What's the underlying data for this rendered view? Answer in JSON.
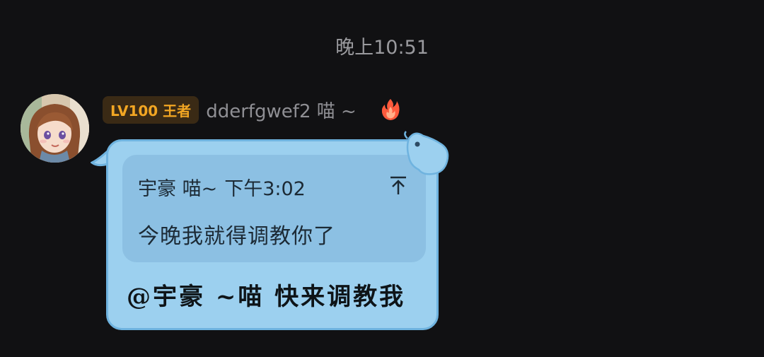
{
  "chat": {
    "timestamp": "晚上10:51",
    "sender": {
      "level_badge": "LV100 王者",
      "name": "dderfgwef2 喵 ~",
      "avatar_icon": "anime-girl-avatar",
      "flair_icon": "fire-icon"
    },
    "message": {
      "quote": {
        "author": "宇豪 喵~",
        "time": "下午3:02",
        "text": "今晚我就得调教你了",
        "pin_icon": "pin-top-icon"
      },
      "text": "@宇豪 ~喵 快来调教我"
    }
  },
  "colors": {
    "background": "#111113",
    "bubble": "#9cd0ef",
    "bubble_border": "#6fb3df",
    "quote_box": "#8cc0e3",
    "level_badge_text": "#f2a623",
    "level_badge_bg": "#3a2a15",
    "muted_text": "#8f8f94"
  }
}
